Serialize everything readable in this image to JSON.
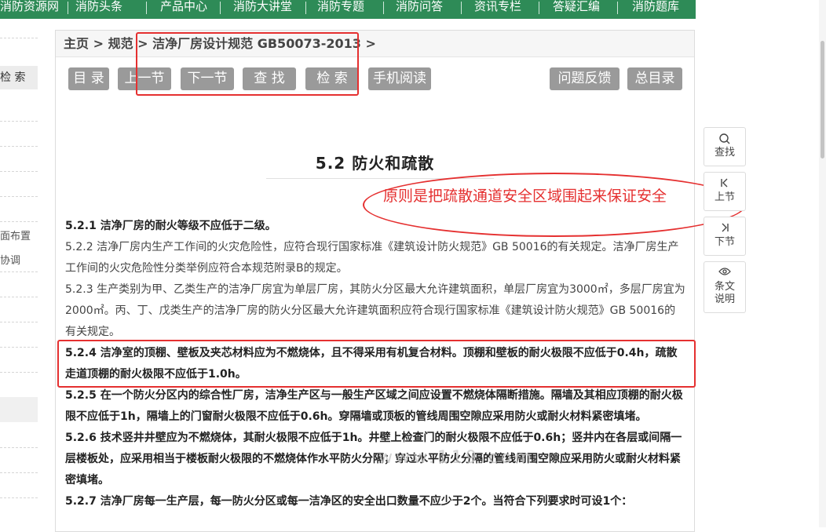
{
  "topnav": {
    "items": [
      "消防资源网",
      "消防头条",
      "产品中心",
      "消防大讲堂",
      "消防专题",
      "消防问答",
      "资讯专栏",
      "答疑汇编",
      "消防题库"
    ]
  },
  "leftpane": {
    "search_tab": "检 索",
    "item_a": "面布置",
    "item_b": "协调"
  },
  "breadcrumb": {
    "home": "主页",
    "sep": ">",
    "level1": "规范",
    "current": "洁净厂房设计规范 GB50073-2013",
    "trail": ">"
  },
  "toolbar": {
    "toc": "目 录",
    "prev": "上一节",
    "next": "下一节",
    "find": "查 找",
    "search": "检 索",
    "mobile": "手机阅读",
    "feedback": "问题反馈",
    "index": "总目录"
  },
  "section_title": "5.2  防火和疏散",
  "annotation": "原则是把疏散通道安全区域围起来保证安全",
  "article": {
    "p1": "5.2.1 洁净厂房的耐火等级不应低于二级。",
    "p2": "5.2.2 洁净厂房内生产工作间的火灾危险性，应符合现行国家标准《建筑设计防火规范》GB 50016的有关规定。洁净厂房生产工作间的火灾危险性分类举例应符合本规范附录B的规定。",
    "p3": "5.2.3 生产类别为甲、乙类生产的洁净厂房宜为单层厂房，其防火分区最大允许建筑面积，单层厂房宜为3000㎡，多层厂房宜为2000㎡。丙、丁、戊类生产的洁净厂房的防火分区最大允许建筑面积应符合现行国家标准《建筑设计防火规范》GB 50016的有关规定。",
    "p4": "5.2.4 洁净室的顶棚、壁板及夹芯材料应为不燃烧体，且不得采用有机复合材料。顶棚和壁板的耐火极限不应低于0.4h，疏散走道顶棚的耐火极限不应低于1.0h。",
    "p5": "5.2.5 在一个防火分区内的综合性厂房，洁净生产区与一般生产区域之间应设置不燃烧体隔断措施。隔墙及其相应顶棚的耐火极限不应低于1h，隔墙上的门窗耐火极限不应低于0.6h。穿隔墙或顶板的管线周围空隙应采用防火或耐火材料紧密填堵。",
    "p6": "5.2.6 技术竖井井壁应为不燃烧体，其耐火极限不应低于1h。井壁上检查门的耐火极限不应低于0.6h；竖井内在各层或间隔一层楼板处，应采用相当于楼板耐火极限的不燃烧体作水平防火分隔；穿过水平防火分隔的管线周围空隙应采用防火或耐火材料紧密填堵。",
    "p7": "5.2.7 洁净厂房每一生产层，每一防火分区或每一洁净区的安全出口数量不应少于2个。当符合下列要求时可设1个："
  },
  "sidebar_tools": {
    "find": "查找",
    "prev": "上节",
    "next": "下节",
    "notes_line1": "条文",
    "notes_line2": "说明"
  },
  "watermark": "www.119.com",
  "colors": {
    "nav_green": "#2e8b57",
    "button_gray": "#9a9a9a",
    "annotation_red": "#e53030"
  }
}
